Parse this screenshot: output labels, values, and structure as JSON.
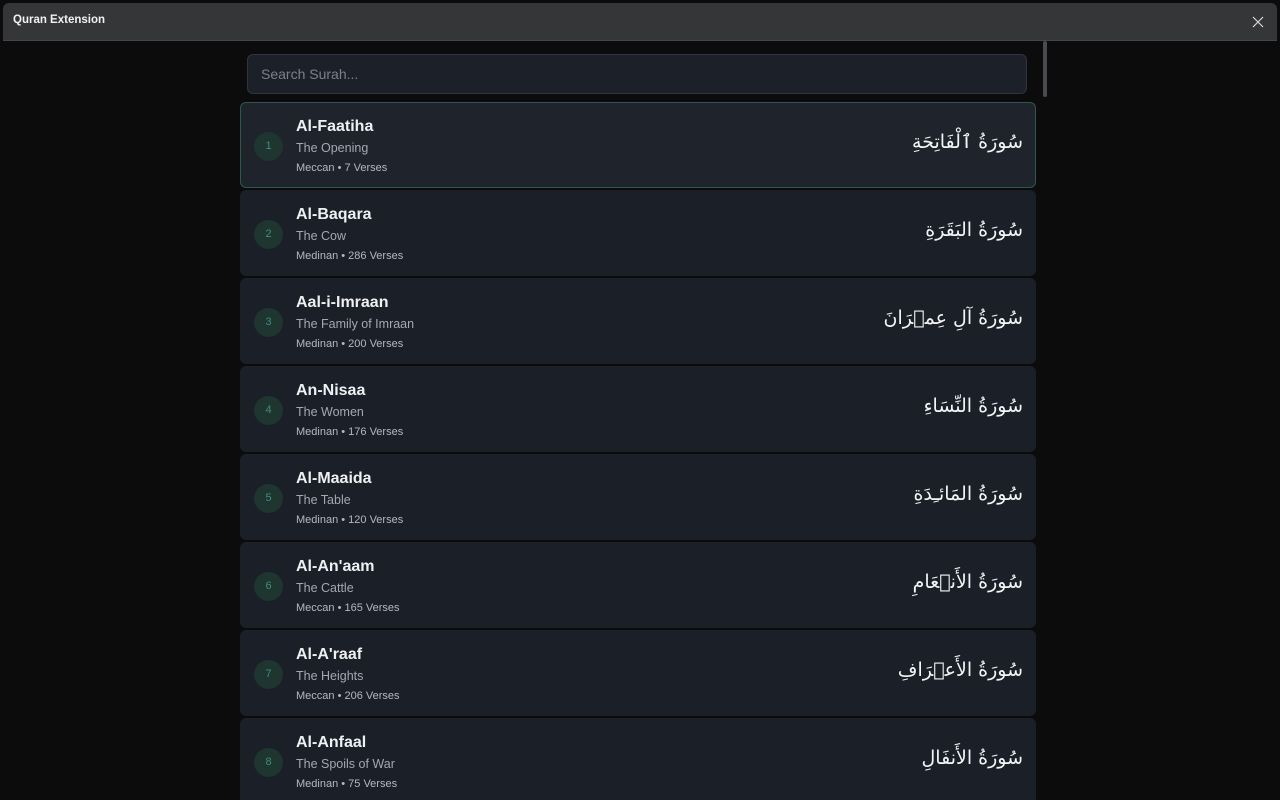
{
  "window": {
    "title": "Quran Extension",
    "close_icon": "close-icon"
  },
  "search": {
    "placeholder": "Search Surah...",
    "value": ""
  },
  "colors": {
    "accent": "#3c8f78",
    "card_bg": "#1b1f27",
    "page_bg": "#0c0c0d"
  },
  "surahs": [
    {
      "number": "1",
      "name": "Al-Faatiha",
      "meaning": "The Opening",
      "meta": "Meccan • 7 Verses",
      "arabic": "سُورَةُ ٱلْفَاتِحَةِ"
    },
    {
      "number": "2",
      "name": "Al-Baqara",
      "meaning": "The Cow",
      "meta": "Medinan • 286 Verses",
      "arabic": "سُورَةُ البَقَرَةِ"
    },
    {
      "number": "3",
      "name": "Aal-i-Imraan",
      "meaning": "The Family of Imraan",
      "meta": "Medinan • 200 Verses",
      "arabic": "سُورَةُ آلِ عِمۡرَانَ"
    },
    {
      "number": "4",
      "name": "An-Nisaa",
      "meaning": "The Women",
      "meta": "Medinan • 176 Verses",
      "arabic": "سُورَةُ النِّسَاءِ"
    },
    {
      "number": "5",
      "name": "Al-Maaida",
      "meaning": "The Table",
      "meta": "Medinan • 120 Verses",
      "arabic": "سُورَةُ المَائـِدَةِ"
    },
    {
      "number": "6",
      "name": "Al-An'aam",
      "meaning": "The Cattle",
      "meta": "Meccan • 165 Verses",
      "arabic": "سُورَةُ الأَنۡعَامِ"
    },
    {
      "number": "7",
      "name": "Al-A'raaf",
      "meaning": "The Heights",
      "meta": "Meccan • 206 Verses",
      "arabic": "سُورَةُ الأَعۡرَافِ"
    },
    {
      "number": "8",
      "name": "Al-Anfaal",
      "meaning": "The Spoils of War",
      "meta": "Medinan • 75 Verses",
      "arabic": "سُورَةُ الأَنفَالِ"
    }
  ]
}
